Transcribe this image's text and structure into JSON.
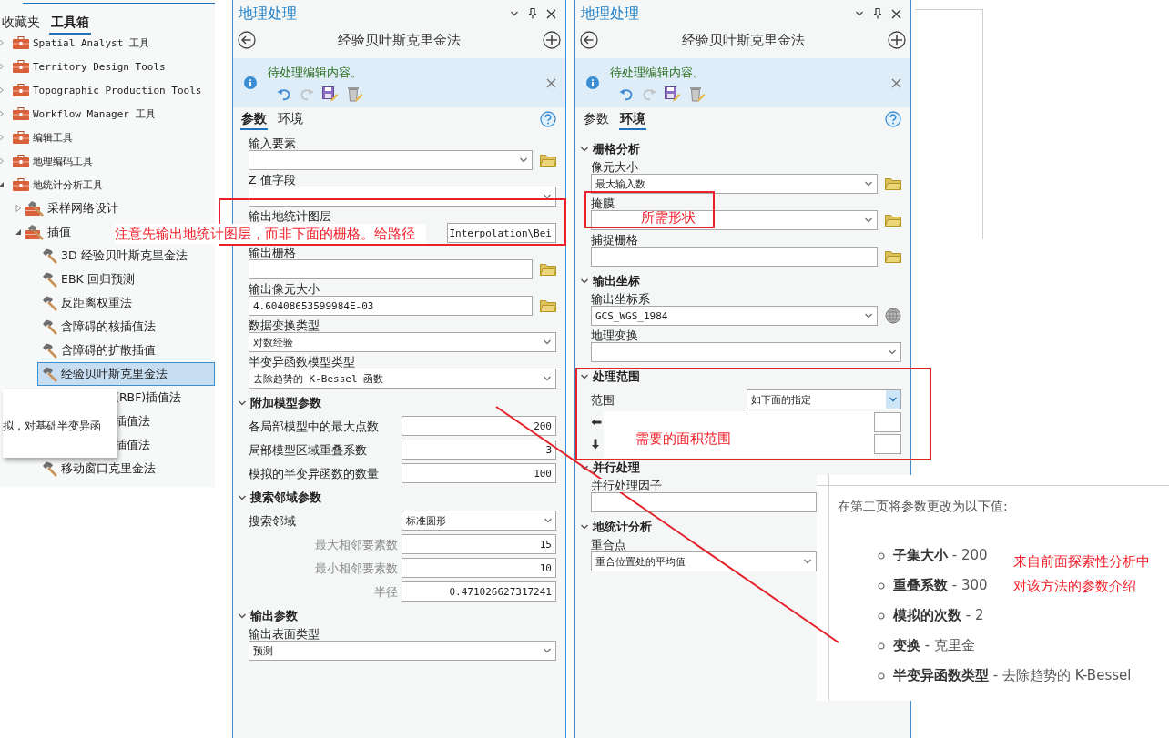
{
  "toolbox_pane": {
    "tabs": [
      {
        "label": "收藏夹",
        "selected": false
      },
      {
        "label": "工具箱",
        "selected": true
      }
    ],
    "tree": [
      {
        "kind": "toolbox",
        "label": "Spatial Analyst 工具",
        "expanded": false
      },
      {
        "kind": "toolbox",
        "label": "Territory Design Tools",
        "expanded": false
      },
      {
        "kind": "toolbox",
        "label": "Topographic Production Tools",
        "expanded": false
      },
      {
        "kind": "toolbox",
        "label": "Workflow Manager 工具",
        "expanded": false
      },
      {
        "kind": "toolbox",
        "label": "编辑工具",
        "expanded": false
      },
      {
        "kind": "toolbox",
        "label": "地理编码工具",
        "expanded": false
      },
      {
        "kind": "toolbox",
        "label": "地统计分析工具",
        "expanded": true,
        "children": [
          {
            "kind": "toolset",
            "label": "采样网络设计",
            "expanded": false
          },
          {
            "kind": "toolset",
            "label": "插值",
            "expanded": true,
            "children": [
              {
                "kind": "tool",
                "label": "3D 经验贝叶斯克里金法",
                "selected": false
              },
              {
                "kind": "tool",
                "label": "EBK 回归预测",
                "selected": false
              },
              {
                "kind": "tool",
                "label": "反距离权重法",
                "selected": false
              },
              {
                "kind": "tool",
                "label": "含障碍的核插值法",
                "selected": false
              },
              {
                "kind": "tool",
                "label": "含障碍的扩散插值",
                "selected": false
              },
              {
                "kind": "tool",
                "label": "经验贝叶斯克里金法",
                "selected": true
              },
              {
                "kind": "covered",
                "label": "(RBF)插值法",
                "selected": false
              },
              {
                "kind": "covered",
                "label": "插值法",
                "selected": false
              },
              {
                "kind": "covered",
                "label": "插值法",
                "selected": false
              },
              {
                "kind": "tool",
                "label": "移动窗口克里金法",
                "selected": false
              }
            ]
          }
        ]
      }
    ],
    "tooltip": {
      "text": "拟，对基础半变异函"
    }
  },
  "panes": [
    {
      "title": "地理处理",
      "tool": "经验贝叶斯克里金法",
      "notice": "待处理编辑内容。",
      "tabs": [
        {
          "label": "参数",
          "selected": true
        },
        {
          "label": "环境",
          "selected": false
        }
      ],
      "sections": [
        {
          "fields": [
            {
              "kind": "dropdown",
              "label": "输入要素",
              "browse": true
            },
            {
              "kind": "dropdown",
              "label": "Z 值字段"
            },
            {
              "kind": "path",
              "label": "输出地统计图层",
              "value": "Interpolation\\Bei"
            },
            {
              "kind": "input",
              "label": "输出栅格",
              "browse": true
            },
            {
              "kind": "input",
              "label": "输出像元大小",
              "value": "4.60408653599984E-03",
              "browse": true
            },
            {
              "kind": "dropdown",
              "label": "数据变换类型",
              "value": "对数经验"
            },
            {
              "kind": "dropdown",
              "label": "半变异函数模型类型",
              "value": "去除趋势的 K-Bessel 函数"
            }
          ]
        },
        {
          "title": "附加模型参数",
          "expanded": true,
          "fields": [
            {
              "kind": "number",
              "label": "各局部模型中的最大点数",
              "value": "200",
              "secondary": false
            },
            {
              "kind": "number",
              "label": "局部模型区域重叠系数",
              "value": "3",
              "secondary": false
            },
            {
              "kind": "number",
              "label": "模拟的半变异函数的数量",
              "value": "100",
              "secondary": false
            }
          ]
        },
        {
          "title": "搜索邻域参数",
          "expanded": true,
          "fields": [
            {
              "kind": "inline-dropdown",
              "label": "搜索邻域",
              "value": "标准圆形",
              "focused": false
            },
            {
              "kind": "number",
              "label": "最大相邻要素数",
              "value": "15",
              "secondary": true
            },
            {
              "kind": "number",
              "label": "最小相邻要素数",
              "value": "10",
              "secondary": true
            },
            {
              "kind": "number",
              "label": "半径",
              "value": "0.471026627317241",
              "secondary": true
            }
          ]
        },
        {
          "title": "输出参数",
          "expanded": true,
          "fields": [
            {
              "kind": "dropdown",
              "label": "输出表面类型",
              "value": "预测"
            }
          ]
        }
      ]
    },
    {
      "title": "地理处理",
      "tool": "经验贝叶斯克里金法",
      "notice": "待处理编辑内容。",
      "tabs": [
        {
          "label": "参数",
          "selected": false
        },
        {
          "label": "环境",
          "selected": true
        }
      ],
      "sections": [
        {
          "title": "栅格分析",
          "expanded": true,
          "fields": [
            {
              "kind": "dropdown",
              "label": "像元大小",
              "value": "最大输入数",
              "browse": true
            },
            {
              "kind": "dropdown",
              "label": "掩膜",
              "browse": true
            },
            {
              "kind": "input",
              "label": "捕捉栅格",
              "browse": true
            }
          ]
        },
        {
          "title": "输出坐标",
          "expanded": true,
          "fields": [
            {
              "kind": "spatial-reference",
              "label": "输出坐标系",
              "value": "GCS_WGS_1984",
              "browse": true
            },
            {
              "kind": "dropdown",
              "label": "地理变换"
            }
          ]
        },
        {
          "title": "处理范围",
          "expanded": true,
          "fields": [
            {
              "kind": "inline-dropdown",
              "label": "范围",
              "value": "如下面的指定",
              "focused": true
            },
            {
              "kind": "extent"
            }
          ]
        },
        {
          "title": "并行处理",
          "expanded": true,
          "fields": [
            {
              "kind": "input",
              "label": "并行处理因子"
            }
          ]
        },
        {
          "title": "地统计分析",
          "expanded": true,
          "fields": [
            {
              "kind": "dropdown",
              "label": "重合点",
              "value": "重合位置处的平均值"
            }
          ]
        }
      ]
    }
  ],
  "article": {
    "intro": "在第二页将参数更改为以下值:",
    "items": [
      "**子集大小** - 200",
      "**重叠系数** - 300",
      "**模拟的次数** - 2",
      "**变换** - 克里金",
      "**半变异函数类型** - 去除趋势的 K-Bessel"
    ]
  },
  "annotations": [
    {
      "kind": "box"
    },
    {
      "kind": "note",
      "text": "注意先输出地统计图层，而非下面的栅格。给路径"
    },
    {
      "kind": "box"
    },
    {
      "kind": "note",
      "text": "所需形状"
    },
    {
      "kind": "box"
    },
    {
      "kind": "note",
      "text": "需要的面积范围"
    },
    {
      "kind": "line"
    },
    {
      "kind": "note",
      "text": "来自前面探索性分析中"
    },
    {
      "kind": "note",
      "text": "对该方法的参数介绍"
    }
  ]
}
